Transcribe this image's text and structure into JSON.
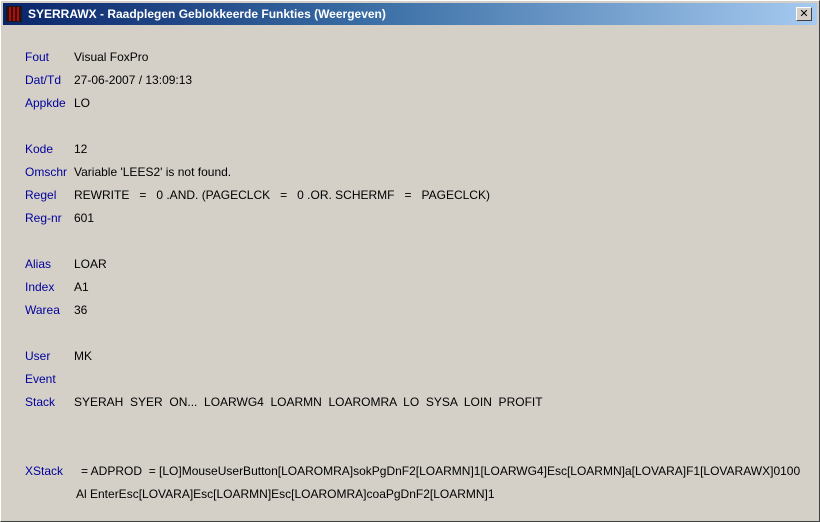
{
  "window": {
    "title": "SYERRAWX - Raadplegen Geblokkeerde Funkties (Weergeven)",
    "close_glyph": "✕"
  },
  "fields": {
    "fout": {
      "label": "Fout",
      "value": "Visual FoxPro"
    },
    "dattd": {
      "label": "Dat/Td",
      "value": "27-06-2007 / 13:09:13"
    },
    "appkde": {
      "label": "Appkde",
      "value": "LO"
    },
    "kode": {
      "label": "Kode",
      "value": "12"
    },
    "omschr": {
      "label": "Omschr",
      "value": "Variable 'LEES2' is not found."
    },
    "regel": {
      "label": "Regel",
      "value": "REWRITE   =   0 .AND. (PAGECLCK   =   0 .OR. SCHERMF   =   PAGECLCK)"
    },
    "regnr": {
      "label": "Reg-nr",
      "value": "601"
    },
    "alias": {
      "label": "Alias",
      "value": "LOAR"
    },
    "index": {
      "label": "Index",
      "value": "A1"
    },
    "warea": {
      "label": "Warea",
      "value": "36"
    },
    "user": {
      "label": "User",
      "value": "MK"
    },
    "event": {
      "label": "Event",
      "value": ""
    },
    "stack": {
      "label": "Stack",
      "value": "SYERAH  SYER  ON...  LOARWG4  LOARMN  LOAROMRA  LO  SYSA  LOIN  PROFIT"
    }
  },
  "xstack": {
    "label": "XStack",
    "line1": "= ADPROD  = [LO]MouseUserButton[LOAROMRA]sokPgDnF2[LOARMN]1[LOARWG4]Esc[LOARMN]a[LOVARA]F1[LOVARAWX]0100",
    "line2": "Al EnterEsc[LOVARA]Esc[LOARMN]Esc[LOAROMRA]coaPgDnF2[LOARMN]1"
  },
  "colors": {
    "label": "#00009c",
    "value": "#000000",
    "window_bg": "#d4d0c8",
    "title_start": "#0a246a",
    "title_end": "#a6caf0"
  },
  "icons": {
    "app": "app-icon",
    "close": "close-icon"
  }
}
